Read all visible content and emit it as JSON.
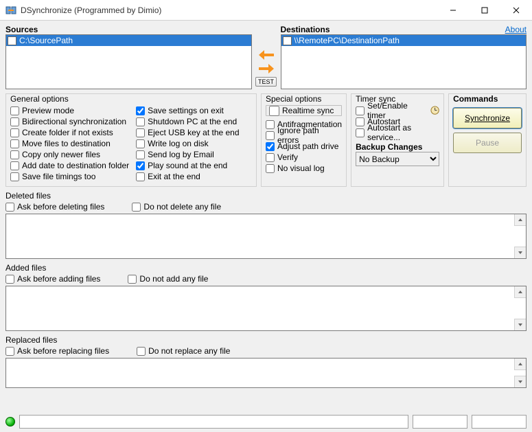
{
  "window": {
    "title": "DSynchronize (Programmed by Dimio)"
  },
  "sources": {
    "label": "Sources",
    "items": [
      "C:\\SourcePath"
    ]
  },
  "destinations": {
    "label": "Destinations",
    "about": "About",
    "items": [
      "\\\\RemotePC\\DestinationPath"
    ]
  },
  "test_button": "TEST",
  "general": {
    "legend": "General options",
    "col1": {
      "preview": "Preview mode",
      "bidir": "Bidirectional synchronization",
      "createfolder": "Create folder if not exists",
      "movefiles": "Move files to destination",
      "copynewer": "Copy only newer files",
      "adddate": "Add date to destination folder",
      "savetimings": "Save file timings too"
    },
    "col2": {
      "savesettings": "Save settings on exit",
      "shutdown": "Shutdown PC at the end",
      "ejectusb": "Eject USB key at the end",
      "writelog": "Write log on disk",
      "sendemail": "Send log by Email",
      "playsound": "Play sound at the end",
      "exitend": "Exit at the end"
    }
  },
  "special": {
    "legend": "Special options",
    "realtime": "Realtime sync",
    "antifrag": "Antifragmentation",
    "ignorepath": "Ignore path errors",
    "adjustdrive": "Adjust path drive",
    "verify": "Verify",
    "novisual": "No visual log"
  },
  "timer": {
    "legend": "Timer sync",
    "enable": "Set/Enable timer",
    "autostart": "Autostart",
    "autoservice": "Autostart as service...",
    "backup_legend": "Backup Changes",
    "backup_value": "No Backup"
  },
  "commands": {
    "legend": "Commands",
    "sync": "Synchronize",
    "pause": "Pause"
  },
  "deleted": {
    "label": "Deleted files",
    "ask": "Ask before deleting files",
    "dont": "Do not delete any file"
  },
  "added": {
    "label": "Added files",
    "ask": "Ask before adding files",
    "dont": "Do not add any file"
  },
  "replaced": {
    "label": "Replaced files",
    "ask": "Ask before replacing files",
    "dont": "Do not replace any file"
  }
}
